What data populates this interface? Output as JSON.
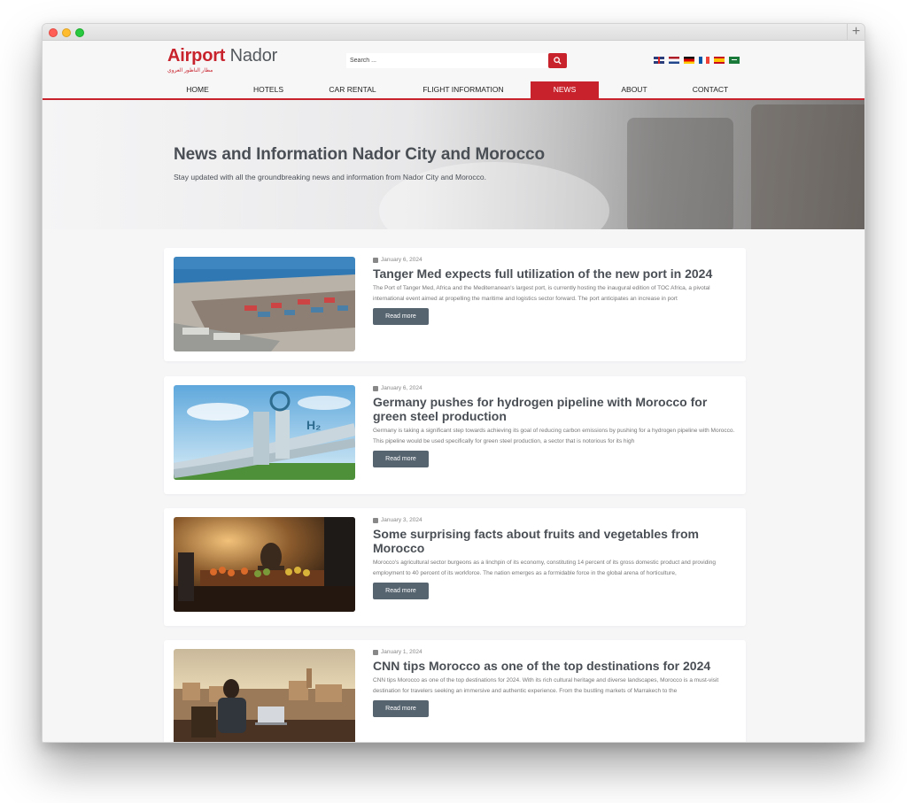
{
  "window": {
    "new_tab_label": "+"
  },
  "site": {
    "logo": {
      "part1": "Airport",
      "part2": "Nador",
      "tagline": "مطار الناظور العروي"
    },
    "search": {
      "placeholder": "Search ..."
    },
    "languages": [
      "English",
      "Nederlands",
      "Deutsch",
      "Français",
      "Español",
      "العربية"
    ],
    "nav": [
      {
        "label": "HOME",
        "active": false
      },
      {
        "label": "HOTELS",
        "active": false
      },
      {
        "label": "CAR RENTAL",
        "active": false
      },
      {
        "label": "FLIGHT INFORMATION",
        "active": false
      },
      {
        "label": "NEWS",
        "active": true
      },
      {
        "label": "ABOUT",
        "active": false
      },
      {
        "label": "CONTACT",
        "active": false
      }
    ],
    "accent_color": "#c8232c",
    "button_color": "#566470"
  },
  "hero": {
    "title": "News and Information Nador City and Morocco",
    "subtitle": "Stay updated with all the groundbreaking news and information from Nador City and Morocco."
  },
  "articles": [
    {
      "date": "January 6, 2024",
      "title": "Tanger Med expects full utilization of the new port in 2024",
      "excerpt": "The Port of Tanger Med, Africa and the Mediterranean's largest port, is currently hosting the inaugural edition of TOC Africa, a pivotal international event aimed at propelling the maritime and logistics sector forward. The port anticipates an increase in port",
      "button": "Read more"
    },
    {
      "date": "January 6, 2024",
      "title": "Germany pushes for hydrogen pipeline with Morocco for green steel production",
      "excerpt": "Germany is taking a significant step towards achieving its goal of reducing carbon emissions by pushing for a hydrogen pipeline with Morocco. This pipeline would be used specifically for green steel production, a sector that is notorious for its high",
      "button": "Read more"
    },
    {
      "date": "January 3, 2024",
      "title": "Some surprising facts about fruits and vegetables from Morocco",
      "excerpt": "Morocco's agricultural sector burgeons as a linchpin of its economy, constituting 14 percent of its gross domestic product and providing employment to 40 percent of its workforce. The nation emerges as a formidable force in the global arena of horticulture,",
      "button": "Read more"
    },
    {
      "date": "January 1, 2024",
      "title": "CNN tips Morocco as one of the top destinations for 2024",
      "excerpt": "CNN tips Morocco as one of the top destinations for 2024. With its rich cultural heritage and diverse landscapes, Morocco is a must-visit destination for travelers seeking an immersive and authentic experience. From the bustling markets of Marrakech to the",
      "button": "Read more"
    }
  ]
}
